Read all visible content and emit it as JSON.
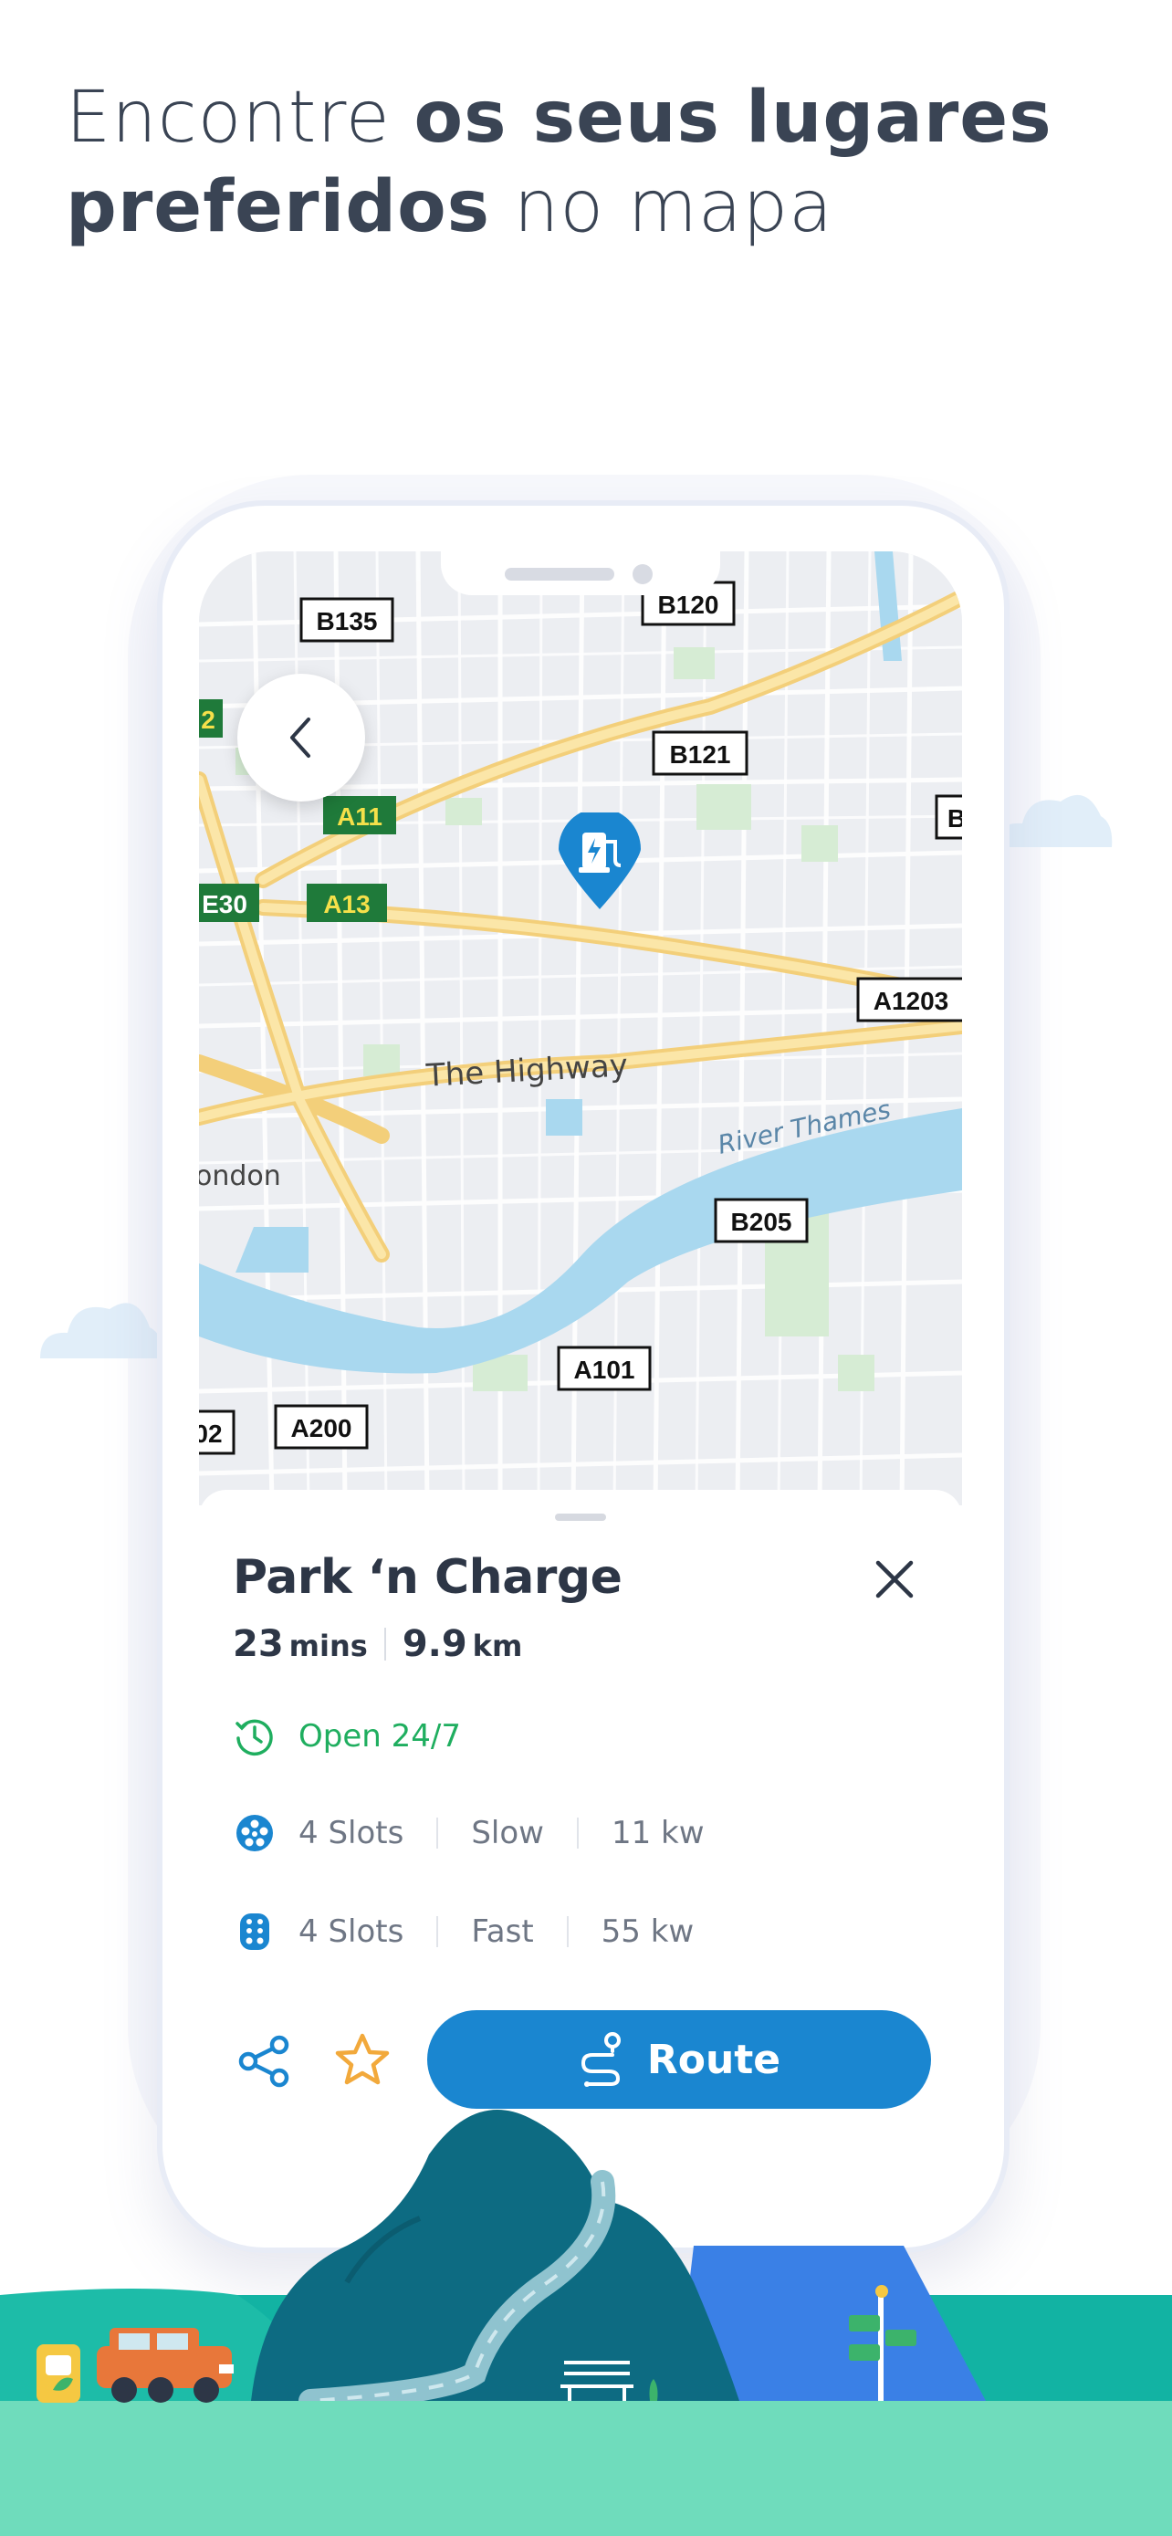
{
  "headline": {
    "normal_1": "Encontre ",
    "bold_1": "os seus lugares",
    "bold_2": "preferidos",
    "normal_2": " no mapa"
  },
  "map": {
    "road_labels": [
      "B135",
      "B120",
      "B121",
      "A11",
      "A13",
      "E30",
      "A1203",
      "B205",
      "A101",
      "A200",
      "2",
      "B",
      "02"
    ],
    "place_labels": [
      "The Highway",
      "River Thames",
      "ondon"
    ]
  },
  "station": {
    "name": "Park ‘n Charge",
    "duration_value": "23",
    "duration_unit": "mins",
    "distance_value": "9.9",
    "distance_unit": "km",
    "hours": "Open 24/7",
    "connectors": [
      {
        "slots": "4 Slots",
        "speed": "Slow",
        "power": "11 kw",
        "icon": "type2-plug-icon"
      },
      {
        "slots": "4 Slots",
        "speed": "Fast",
        "power": "55 kw",
        "icon": "ccs-plug-icon"
      }
    ]
  },
  "actions": {
    "route_label": "Route",
    "share_icon": "share-icon",
    "favorite_icon": "star-icon"
  },
  "colors": {
    "primary": "#1a86d0",
    "open_green": "#1fae5f",
    "favorite": "#f2a93b",
    "ground_teal": "#12b3a3",
    "ground_light": "#6fdcbc"
  }
}
